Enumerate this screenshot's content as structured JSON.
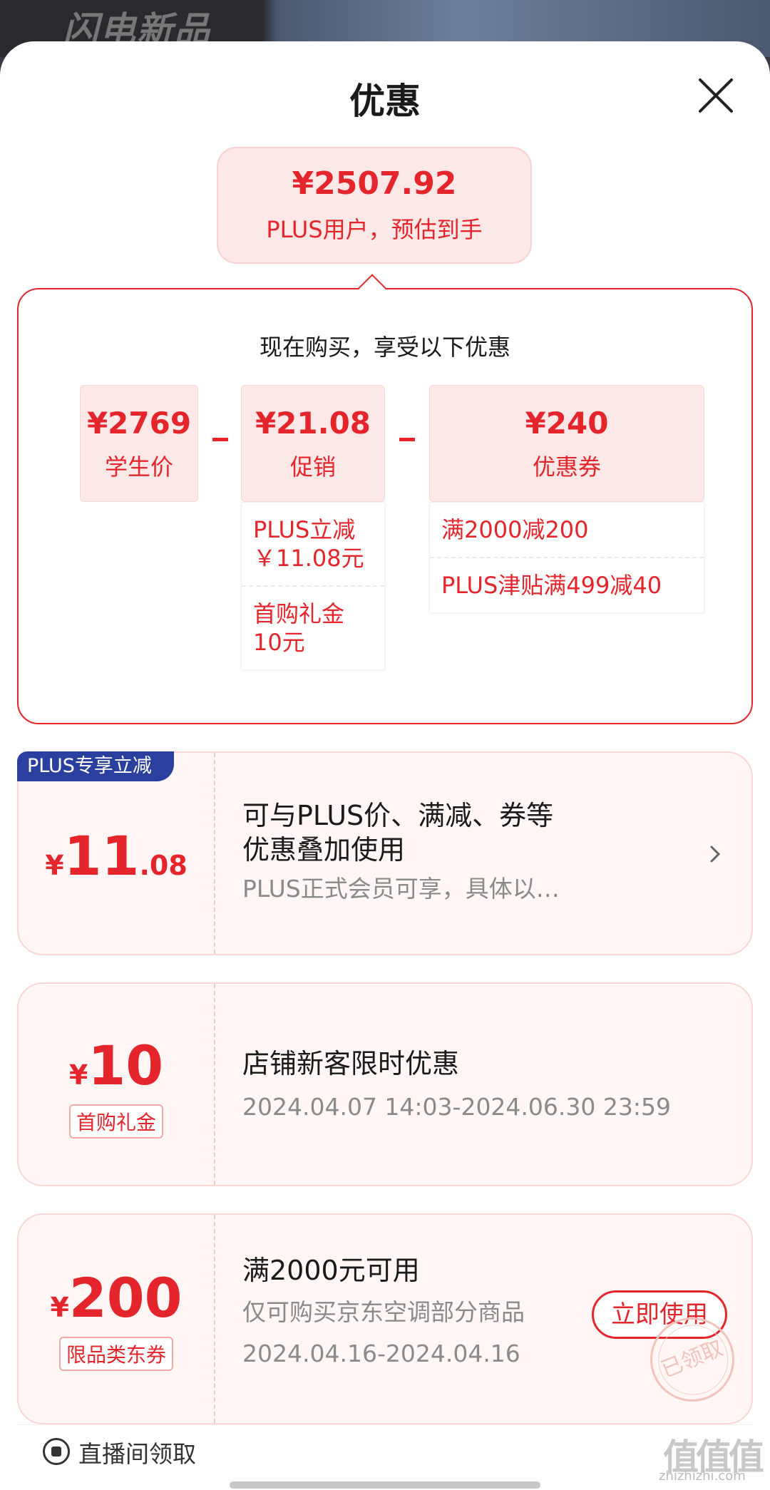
{
  "background": {
    "logo_text": "闪电新品"
  },
  "sheet": {
    "title": "优惠"
  },
  "estimate": {
    "price": "¥2507.92",
    "note": "PLUS用户，预估到手"
  },
  "breakdown": {
    "heading": "现在购买，享受以下优惠",
    "base": {
      "amount": "¥2769",
      "label": "学生价"
    },
    "promo": {
      "amount": "¥21.08",
      "label": "促销",
      "items": [
        {
          "line1": "PLUS立减",
          "line2": "￥11.08元"
        },
        {
          "line1": "首购礼金",
          "line2": "10元"
        }
      ]
    },
    "coupon": {
      "amount": "¥240",
      "label": "优惠券",
      "items": [
        "满2000减200",
        "PLUS津贴满499减40"
      ]
    }
  },
  "coupons": [
    {
      "badge": "PLUS专享立减",
      "currency": "¥",
      "amount_int": "11",
      "amount_dec": ".08",
      "title_line1": "可与PLUS价、满减、券等",
      "title_line2": "优惠叠加使用",
      "desc": "PLUS正式会员可享，具体以…"
    },
    {
      "currency": "¥",
      "amount_int": "10",
      "tag": "首购礼金",
      "title": "店铺新客限时优惠",
      "desc": "2024.04.07 14:03-2024.06.30 23:59"
    },
    {
      "currency": "¥",
      "amount_int": "200",
      "tag": "限品类东券",
      "title": "满2000元可用",
      "desc": "仅可购买京东空调部分商品",
      "date": "2024.04.16-2024.04.16",
      "button": "立即使用",
      "stamp": "已领取"
    }
  ],
  "live": {
    "label": "直播间领取"
  },
  "watermark": {
    "main": "值值值",
    "sub": "zhizhizhi.com"
  },
  "colors": {
    "accent": "#e4262c",
    "plus_blue": "#2a3f9e",
    "coupon_bg": "#fff6f5"
  }
}
